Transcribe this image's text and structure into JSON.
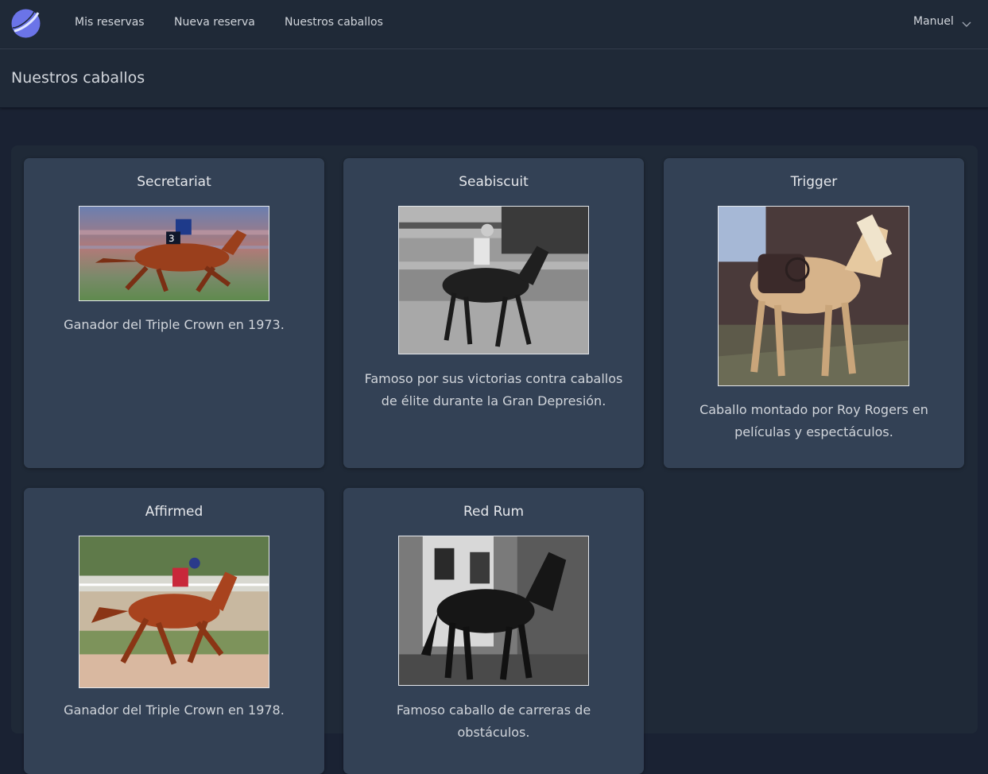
{
  "nav": {
    "links": [
      "Mis reservas",
      "Nueva reserva",
      "Nuestros caballos"
    ],
    "user": "Manuel"
  },
  "header": {
    "title": "Nuestros caballos"
  },
  "horses": [
    {
      "name": "Secretariat",
      "description": "Ganador del Triple Crown en 1973."
    },
    {
      "name": "Seabiscuit",
      "description": "Famoso por sus victorias contra caballos de élite durante la Gran Depresión."
    },
    {
      "name": "Trigger",
      "description": "Caballo montado por Roy Rogers en películas y espectáculos."
    },
    {
      "name": "Affirmed",
      "description": "Ganador del Triple Crown en 1978."
    },
    {
      "name": "Red Rum",
      "description": "Famoso caballo de carreras de obstáculos."
    }
  ],
  "colors": {
    "background": "#1a2233",
    "navbar": "#1f2937",
    "card": "#334155",
    "logo": "#6366f1"
  }
}
